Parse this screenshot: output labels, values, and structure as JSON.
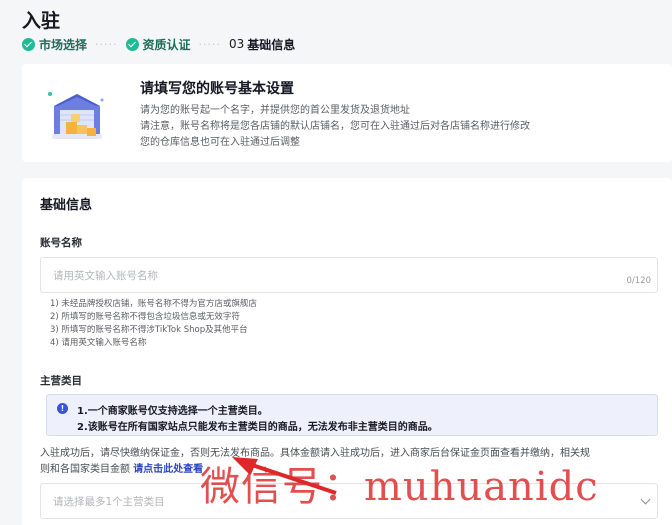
{
  "page": {
    "title": "入驻"
  },
  "steps": [
    {
      "label": "市场选择",
      "status": "done"
    },
    {
      "label": "资质认证",
      "status": "done"
    },
    {
      "number": "03",
      "label": "基础信息",
      "status": "current"
    }
  ],
  "info_card": {
    "title": "请填写您的账号基本设置",
    "lines": [
      "请为您的账号起一个名字，并提供您的首公里发货及退货地址",
      "请注意，账号名称将是您各店铺的默认店铺名，您可在入驻通过后对各店铺名称进行修改",
      "您的仓库信息也可在入驻通过后调整"
    ]
  },
  "form": {
    "section_title": "基础信息",
    "account_name": {
      "label": "账号名称",
      "placeholder": "请用英文输入账号名称",
      "counter": "0/120",
      "hints": [
        "1) 未经品牌授权店铺，账号名称不得为官方店或旗舰店",
        "2) 所填写的账号名称不得包含垃圾信息或无效字符",
        "3) 所填写的账号名称不得涉TikTok Shop及其他平台",
        "4) 请用英文输入账号名称"
      ]
    },
    "main_category": {
      "label": "主营类目",
      "alert_lines": [
        "1.一个商家账号仅支持选择一个主营类目。",
        "2.该账号在所有国家站点只能发布主营类目的商品，无法发布非主营类目的商品。"
      ],
      "description_line1": "入驻成功后，请尽快缴纳保证金，否则无法发布商品。具体金额请入驻成功后，进入商家后台保证金页面查看并缴纳，相关规",
      "description_line2": "则和各国家类目金额 ",
      "description_link": "请点击此处查看",
      "select_placeholder": "请选择最多1个主营类目"
    }
  },
  "watermark": "微信号：muhuanidc",
  "colors": {
    "success": "#1fbb94",
    "link": "#2a44c9",
    "alert_bg": "#eef0fb",
    "watermark": "#dc2828"
  }
}
